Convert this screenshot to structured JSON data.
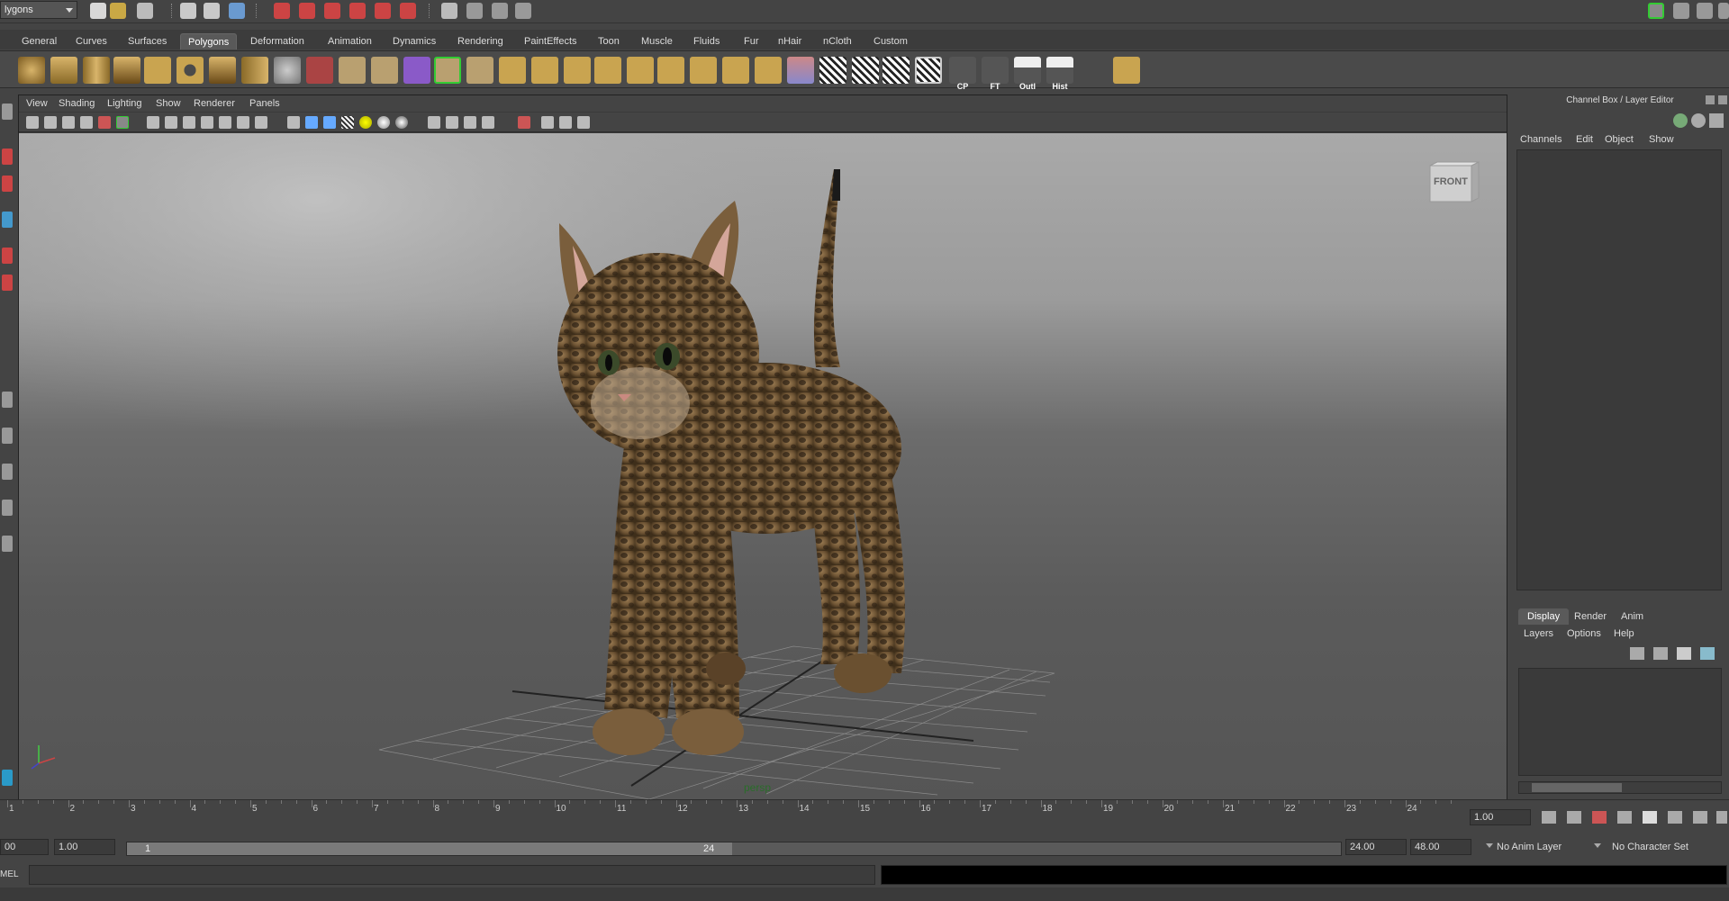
{
  "top": {
    "mode_menu": "lygons"
  },
  "shelf_tabs": [
    "General",
    "Curves",
    "Surfaces",
    "Polygons",
    "Deformation",
    "Animation",
    "Dynamics",
    "Rendering",
    "PaintEffects",
    "Toon",
    "Muscle",
    "Fluids",
    "Fur",
    "nHair",
    "nCloth",
    "Custom"
  ],
  "shelf_active": "Polygons",
  "shelf_labels": {
    "cp": "CP",
    "ft": "FT",
    "outl": "Outl",
    "hist": "Hist"
  },
  "panel_menu": [
    "View",
    "Shading",
    "Lighting",
    "Show",
    "Renderer",
    "Panels"
  ],
  "viewport": {
    "camera": "persp",
    "viewcube": "FRONT"
  },
  "channel_box": {
    "title": "Channel Box / Layer Editor",
    "menu": [
      "Channels",
      "Edit",
      "Object",
      "Show"
    ]
  },
  "layer_editor": {
    "tabs": [
      "Display",
      "Render",
      "Anim"
    ],
    "active": "Display",
    "menu": [
      "Layers",
      "Options",
      "Help"
    ]
  },
  "timeline": {
    "ticks": [
      "1",
      "2",
      "3",
      "4",
      "5",
      "6",
      "7",
      "8",
      "9",
      "10",
      "11",
      "12",
      "13",
      "14",
      "15",
      "16",
      "17",
      "18",
      "19",
      "20",
      "21",
      "22",
      "23",
      "24"
    ],
    "current_frame": "1.00"
  },
  "range": {
    "start_clip": "00",
    "start": "1.00",
    "slider_start": "1",
    "slider_end": "24",
    "end": "24.00",
    "end_total": "48.00",
    "anim_layer": "No Anim Layer",
    "char_set": "No Character Set"
  },
  "command_line": {
    "label": "MEL"
  },
  "colors": {
    "accent_active_tab": "#5a5a5a",
    "shelf_bg": "#4a4a4a",
    "viewport_top": "#a9a9a9",
    "viewport_bottom": "#555555"
  }
}
